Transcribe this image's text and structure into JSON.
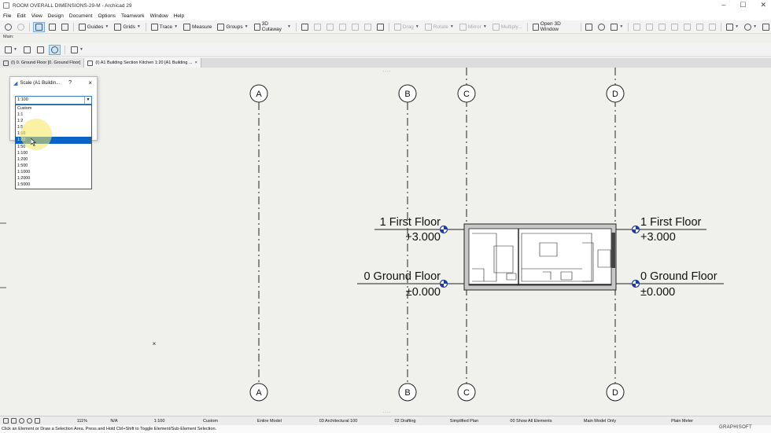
{
  "window": {
    "title": "ROOM OVERALL DIMENSIONS-29-M - Archicad 29"
  },
  "menu": [
    "File",
    "Edit",
    "View",
    "Design",
    "Document",
    "Options",
    "Teamwork",
    "Window",
    "Help"
  ],
  "toolbar": {
    "guides": "Guides",
    "grids": "Grids",
    "trace": "Trace",
    "measure": "Measure",
    "groups": "Groups",
    "cutaway": "3D Cutaway",
    "drag": "Drag",
    "rotate": "Rotate",
    "mirror": "Mirror",
    "multiply": "Multiply...",
    "open3d": "Open 3D Window"
  },
  "toolbox_label": "Main:",
  "tabs": [
    {
      "label": "(I) 0. Ground Floor [0. Ground Floor]"
    },
    {
      "label": "(I) A1 Building Section Kitchen 1:20 [A1 Building ..."
    }
  ],
  "dialog": {
    "title": "Scale (A1 Buildin...",
    "help": "?",
    "close": "×",
    "value": "1:100",
    "options": [
      "Custom",
      "1:1",
      "1:2",
      "1:5",
      "1:10",
      "1:20",
      "1:50",
      "1:100",
      "1:200",
      "1:500",
      "1:1000",
      "1:2000",
      "1:5000"
    ],
    "selected": "1:20"
  },
  "drawing": {
    "grid_labels": [
      "A",
      "B",
      "C",
      "D"
    ],
    "levels": [
      {
        "name": "1 First Floor",
        "elevation": "+3.000"
      },
      {
        "name": "0 Ground Floor",
        "elevation": "±0.000"
      }
    ],
    "marker": "×"
  },
  "status": {
    "zoom": "111%",
    "angle": "N/A",
    "scale": "1:100",
    "custom": "Custom",
    "model": "Entire Model",
    "layer": "03 Architectural 100",
    "pen": "02 Drafting",
    "plan": "Simplified Plan",
    "show": "00 Show All Elements",
    "view": "Main Model Only",
    "unit": "Plain Meter"
  },
  "hint": "Click an Element or Draw a Selection Area. Press and Hold Ctrl+Shift to Toggle Element/Sub-Element Selection.",
  "brand": "GRAPHISOFT",
  "colors": {
    "selection": "#0a64c8",
    "marker": "#1f3aa0",
    "halo": "#f5e65a"
  }
}
